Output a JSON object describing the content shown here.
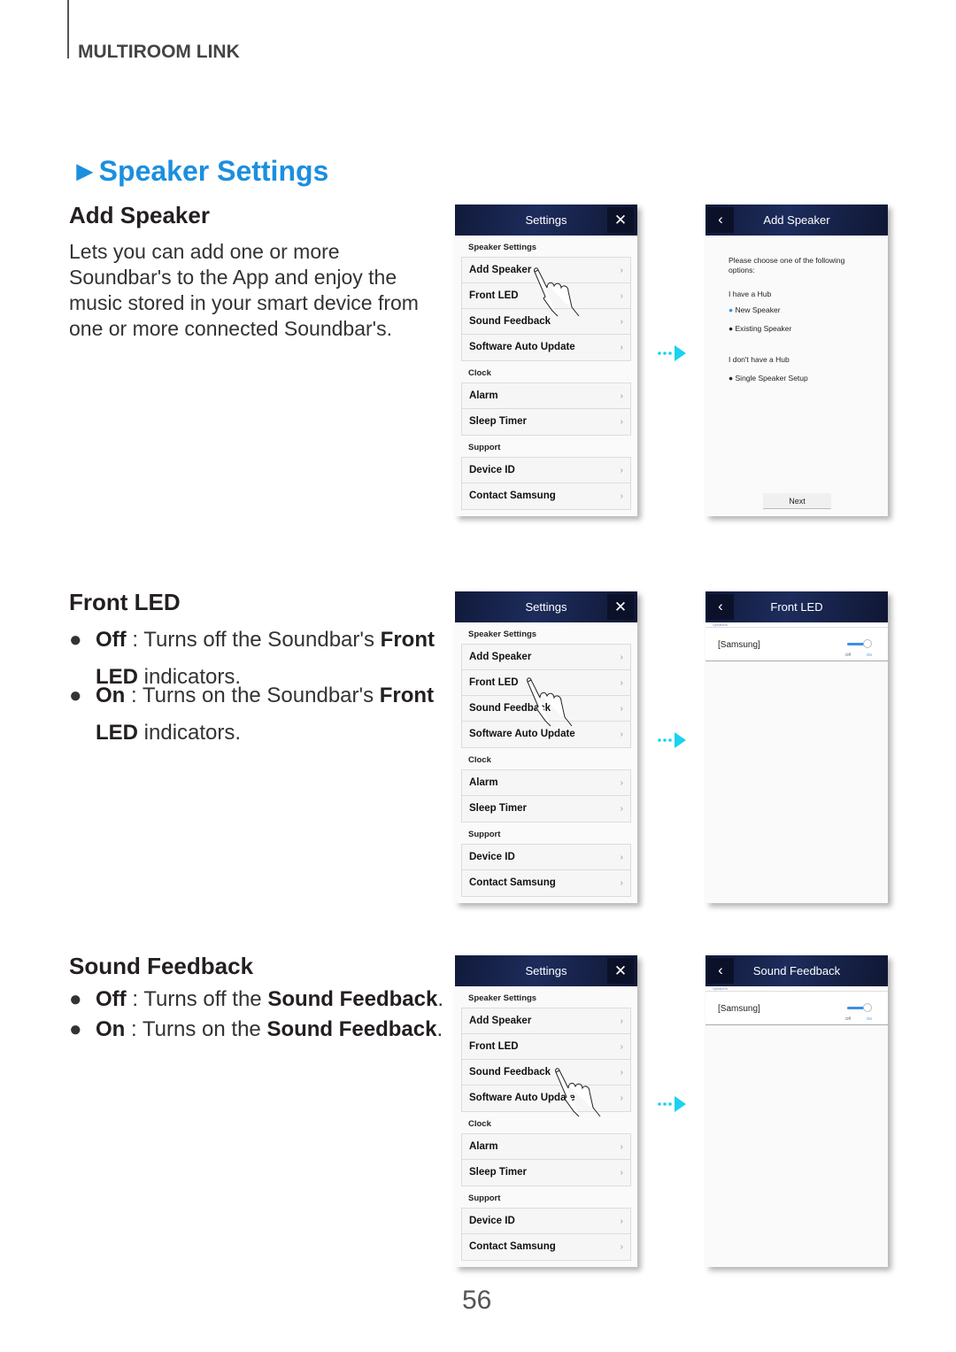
{
  "chapter": "MULTIROOM LINK",
  "title_marker": "►",
  "title": "Speaker Settings",
  "sections": {
    "add": {
      "heading": "Add Speaker",
      "body": [
        "Lets you can add one or more",
        "Soundbar's to the App and enjoy the",
        "music stored in your smart device from",
        "one or more connected Soundbar's."
      ]
    },
    "led": {
      "heading": "Front LED",
      "bullets": [
        {
          "bullet": "●",
          "key": "Off",
          "sep": " : ",
          "text": "Turns off the Soundbar's ",
          "bold": "Front",
          "line2": "LED",
          "rest": " indicators."
        },
        {
          "bullet": "●",
          "key": "On",
          "sep": " : ",
          "text": "Turns on the Soundbar's ",
          "bold": "Front",
          "line2": "LED",
          "rest": " indicators."
        }
      ]
    },
    "fb": {
      "heading": "Sound Feedback",
      "bullets": [
        {
          "bullet": "●",
          "key": "Off",
          "sep": " : ",
          "text": "Turns off the ",
          "bold": "Sound Feedback",
          "rest": "."
        },
        {
          "bullet": "●",
          "key": "On",
          "sep": " : ",
          "text": "Turns on the ",
          "bold": "Sound Feedback",
          "rest": "."
        }
      ]
    }
  },
  "settings_screen": {
    "title": "Settings",
    "close_icon": "close-icon",
    "groups": [
      {
        "label": "Speaker Settings",
        "items": [
          "Add Speaker",
          "Front LED",
          "Sound Feedback",
          "Software Auto Update"
        ]
      },
      {
        "label": "Clock",
        "items": [
          "Alarm",
          "Sleep Timer"
        ]
      },
      {
        "label": "Support",
        "items": [
          "Device ID",
          "Contact Samsung"
        ]
      }
    ],
    "chevron": "›"
  },
  "add_speaker_screen": {
    "title": "Add Speaker",
    "back_icon": "back-icon",
    "prompt": "Please choose one of the following options:",
    "hub_label": "I have a Hub",
    "hub_options": [
      "New Speaker",
      "Existing Speaker"
    ],
    "nohub_label": "I don't have a Hub",
    "nohub_options": [
      "Single Speaker Setup"
    ],
    "selected_option": "New Speaker",
    "next": "Next"
  },
  "front_led_screen": {
    "title": "Front LED",
    "section": "Speakers",
    "device": "[Samsung]",
    "toggle": {
      "off": "Off",
      "on": "On",
      "state": "On"
    }
  },
  "sound_feedback_screen": {
    "title": "Sound Feedback",
    "section": "Speakers",
    "device": "[Samsung]",
    "toggle": {
      "off": "Off",
      "on": "On",
      "state": "On"
    }
  },
  "colors": {
    "title": "#1c8fde",
    "arrow": "#19d3f0",
    "header": "#1d2c5c",
    "toggle": "#3b8fe8"
  },
  "page_number": "56"
}
